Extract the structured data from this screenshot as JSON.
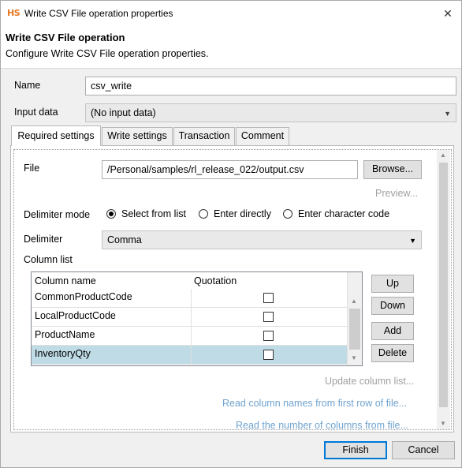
{
  "window": {
    "app_icon": "HS",
    "title": "Write CSV File operation properties",
    "close": "✕"
  },
  "header": {
    "title": "Write CSV File operation",
    "description": "Configure Write CSV File operation properties."
  },
  "form": {
    "name_label": "Name",
    "name_value": "csv_write",
    "input_label": "Input data",
    "input_value": "(No input data)"
  },
  "tabs": [
    {
      "label": "Required settings",
      "active": true
    },
    {
      "label": "Write settings"
    },
    {
      "label": "Transaction"
    },
    {
      "label": "Comment"
    }
  ],
  "required": {
    "file_label": "File",
    "file_value": "/Personal/samples/rl_release_022/output.csv",
    "browse": "Browse...",
    "preview": "Preview...",
    "delimiter_mode_label": "Delimiter mode",
    "mode_options": [
      "Select from list",
      "Enter directly",
      "Enter character code"
    ],
    "mode_selected": "Select from list",
    "delimiter_label": "Delimiter",
    "delimiter_value": "Comma",
    "column_list_label": "Column list",
    "columns": {
      "headers": [
        "Column name",
        "Quotation"
      ],
      "rows": [
        {
          "name": "CommonProductCode",
          "quotation": false
        },
        {
          "name": "LocalProductCode",
          "quotation": false
        },
        {
          "name": "ProductName",
          "quotation": false
        },
        {
          "name": "InventoryQty",
          "quotation": false,
          "selected": true
        }
      ]
    },
    "up": "Up",
    "down": "Down",
    "add": "Add",
    "delete": "Delete",
    "update_columns": "Update column list...",
    "read_names": "Read column names from first row of file...",
    "read_count": "Read the number of columns from file..."
  },
  "footer": {
    "finish": "Finish",
    "cancel": "Cancel"
  }
}
